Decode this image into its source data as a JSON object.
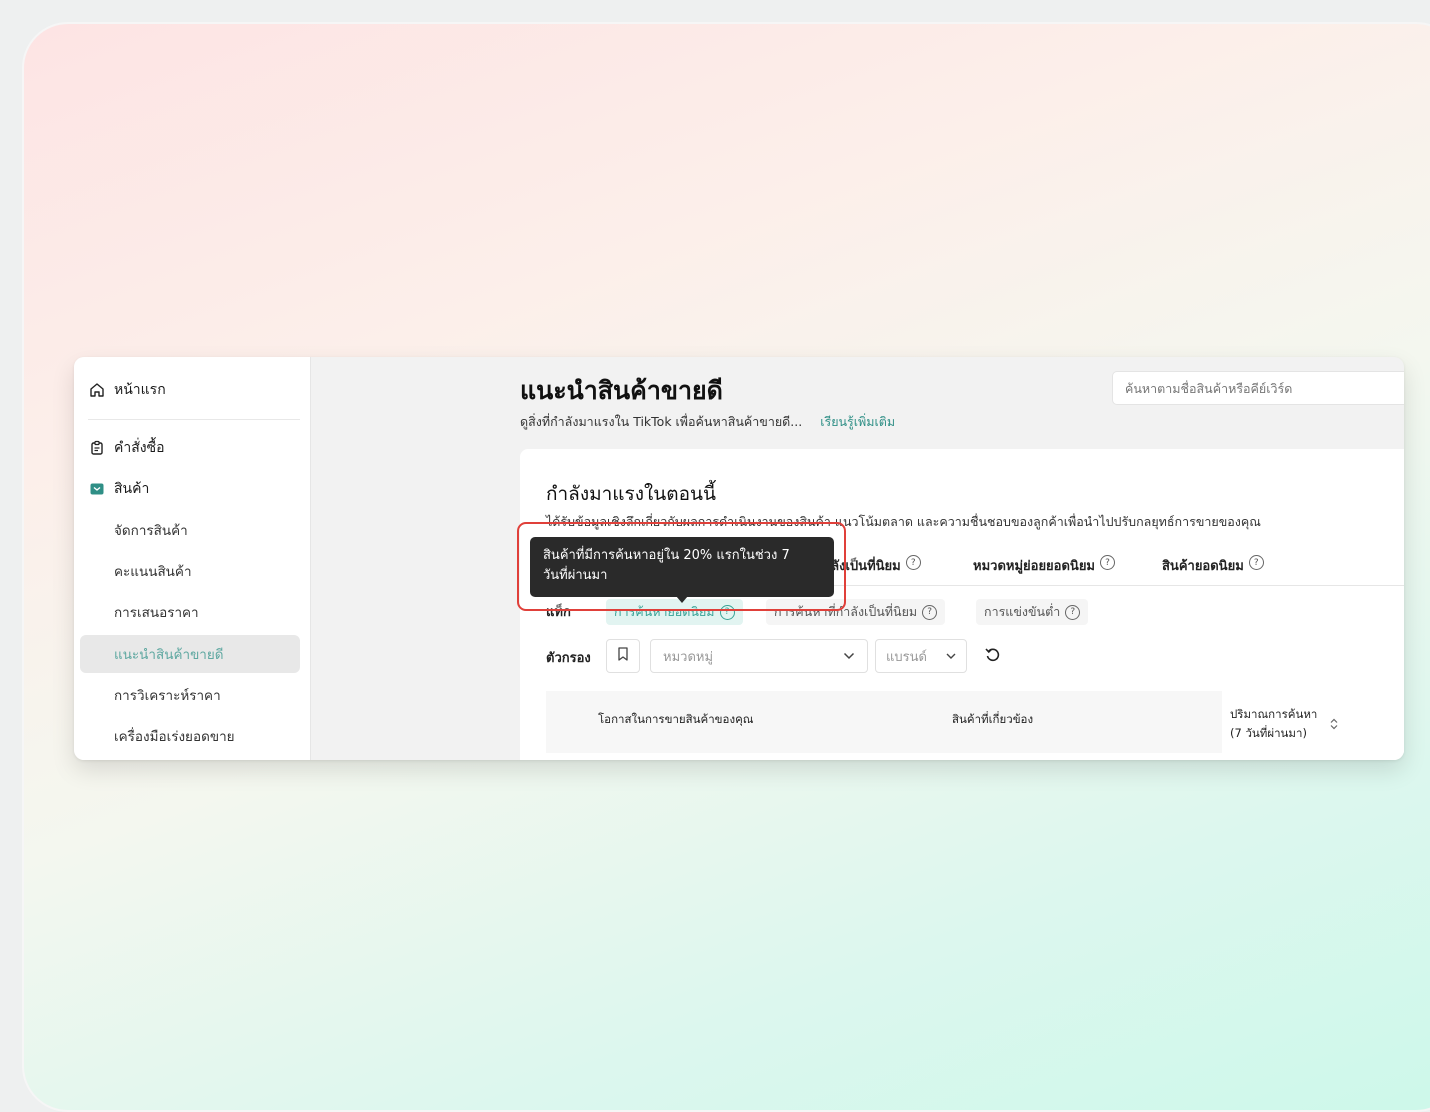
{
  "sidebar": {
    "home": "หน้าแรก",
    "orders": "คำสั่งซื้อ",
    "products": "สินค้า",
    "sub_items": [
      "จัดการสินค้า",
      "คะแนนสินค้า",
      "การเสนอราคา",
      "แนะนำสินค้าขายดี",
      "การวิเคราะห์ราคา",
      "เครื่องมือเร่งยอดขาย"
    ],
    "active_index": 3
  },
  "header": {
    "title": "แนะนำสินค้าขายดี",
    "subtitle": "ดูสิ่งที่กำลังมาแรงใน TikTok เพื่อค้นหาสินค้าขายดี...",
    "learn_more": "เรียนรู้เพิ่มเติม",
    "search_placeholder": "ค้นหาตามชื่อสินค้าหรือคีย์เวิร์ด"
  },
  "section": {
    "title": "กำลังมาแรงในตอนนี้",
    "description": "ได้รับข้อมูลเชิงลึกเกี่ยวกับผลการดำเนินงานของสินค้า แนวโน้มตลาด และความชื่นชอบของลูกค้าเพื่อนำไปปรับกลยุทธ์การขายของคุณ"
  },
  "tabs": [
    "กำลังเป็นที่นิยม",
    "หมวดหมู่ย่อยยอดนิยม",
    "สินค้ายอดนิยม"
  ],
  "tag_filter": {
    "label": "แท็ก",
    "chips": [
      "การค้นหายอดนิยม",
      "การค้นหาที่กำลังเป็นที่นิยม",
      "การแข่งขันต่ำ"
    ],
    "active_index": 0
  },
  "filters": {
    "label": "ตัวกรอง",
    "category_placeholder": "หมวดหมู่",
    "brand_placeholder": "แบรนด์"
  },
  "table": {
    "headers": [
      "โอกาสในการขายสินค้าของคุณ",
      "สินค้าที่เกี่ยวข้อง",
      "ปริมาณการค้นหา",
      "(7 วันที่ผ่านมา)"
    ]
  },
  "tooltip": {
    "line1": "สินค้าที่มีการค้นหาอยู่ใน 20% แรกในช่วง 7",
    "line2": "วันที่ผ่านมา"
  },
  "colors": {
    "accent": "#2f8f86",
    "chip_active_bg": "#e2f4f1",
    "highlight": "#e0403a",
    "tooltip_bg": "#2a2a2a"
  }
}
